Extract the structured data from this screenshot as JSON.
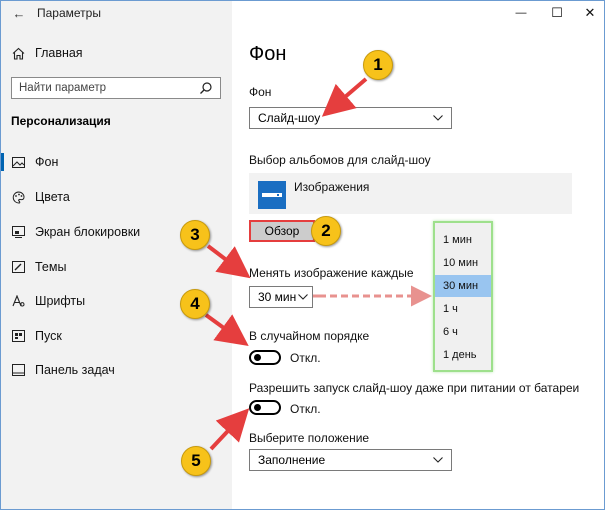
{
  "window": {
    "title": "Параметры",
    "controls": {
      "minimize": "—",
      "maximize": "☐",
      "close": "✕"
    }
  },
  "sidebar": {
    "back_glyph": "←",
    "home_label": "Главная",
    "search_placeholder": "Найти параметр",
    "section_title": "Персонализация",
    "items": [
      {
        "label": "Фон",
        "icon": "image-icon",
        "selected": true
      },
      {
        "label": "Цвета",
        "icon": "palette-icon",
        "selected": false
      },
      {
        "label": "Экран блокировки",
        "icon": "lock-screen-icon",
        "selected": false
      },
      {
        "label": "Темы",
        "icon": "brush-icon",
        "selected": false
      },
      {
        "label": "Шрифты",
        "icon": "font-icon",
        "selected": false
      },
      {
        "label": "Пуск",
        "icon": "start-icon",
        "selected": false
      },
      {
        "label": "Панель задач",
        "icon": "taskbar-icon",
        "selected": false
      }
    ]
  },
  "main": {
    "page_title": "Фон",
    "background_label": "Фон",
    "background_value": "Слайд-шоу",
    "albums_label": "Выбор альбомов для слайд-шоу",
    "album_name": "Изображения",
    "browse_label": "Обзор",
    "interval_label": "Менять изображение каждые",
    "interval_value": "30 мин",
    "interval_options": [
      "1 мин",
      "10 мин",
      "30 мин",
      "1 ч",
      "6 ч",
      "1 день"
    ],
    "interval_selected": "30 мин",
    "shuffle_label": "В случайном порядке",
    "shuffle_state": "Откл.",
    "battery_label": "Разрешить запуск слайд-шоу даже при питании от батареи",
    "battery_state": "Откл.",
    "fit_label": "Выберите положение",
    "fit_value": "Заполнение"
  },
  "annotations": {
    "badges": [
      "1",
      "2",
      "3",
      "4",
      "5"
    ],
    "badge_color": "#f7c21a",
    "arrow_color": "#e53e3e"
  }
}
